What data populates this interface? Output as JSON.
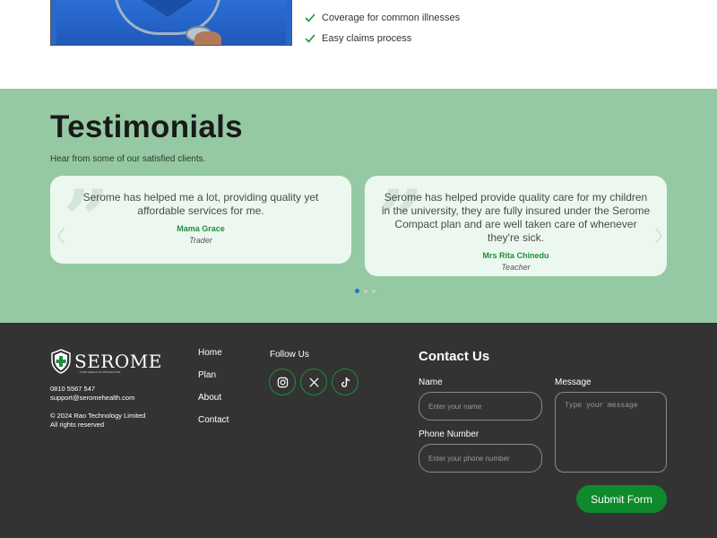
{
  "features": {
    "items": [
      "Coverage for common illnesses",
      "Easy claims process"
    ],
    "icon": "check-icon",
    "color": "#1e8e3e"
  },
  "testimonials": {
    "title": "Testimonials",
    "subtitle": "Hear from some of our satisfied clients.",
    "cards": [
      {
        "text": "Serome has helped me a lot, providing quality yet affordable services for me.",
        "name": "Mama Grace",
        "role": "Trader"
      },
      {
        "text": "Serome has helped provide quality care for my children in the university, they are fully insured under the Serome Compact plan and are well taken care of whenever they're sick.",
        "name": "Mrs Rita Chinedu",
        "role": "Teacher"
      }
    ],
    "quote_glyph": "”",
    "background": "#95c9a3",
    "accent": "#1e8e3e"
  },
  "footer": {
    "logo": {
      "brand": "SEROME",
      "tagline": "...YOUR SHIELD OF PROTECTION"
    },
    "phone": "0810 5567 547",
    "email": "support@seromehealth.com",
    "copyright": "© 2024 Rao Technology Limited",
    "rights": "All rights reserved",
    "nav": [
      "Home",
      "Plan",
      "About",
      "Contact"
    ],
    "follow_label": "Follow Us",
    "socials": [
      "instagram-icon",
      "x-icon",
      "tiktok-icon"
    ],
    "contact": {
      "title": "Contact Us",
      "name_label": "Name",
      "name_placeholder": "Enter your name",
      "phone_label": "Phone Number",
      "phone_placeholder": "Enter your phone number",
      "message_label": "Message",
      "message_placeholder": "Type your message",
      "submit_label": "Submit Form"
    },
    "background": "#333333",
    "button_color": "#0e8a2c"
  }
}
